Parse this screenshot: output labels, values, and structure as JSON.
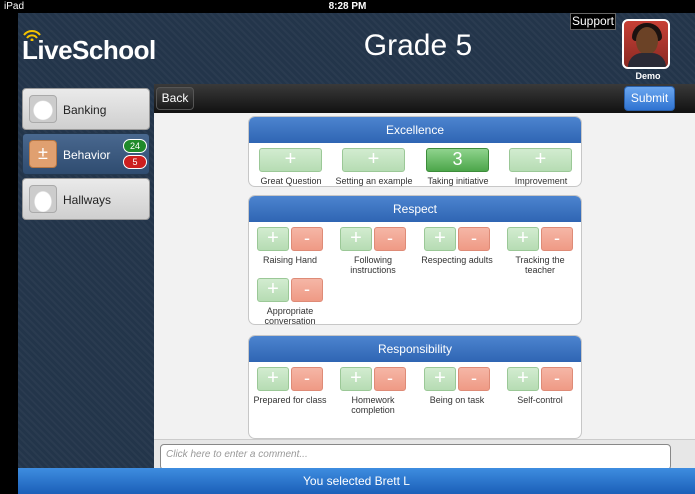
{
  "statusbar": {
    "device": "iPad",
    "time": "8:28 PM"
  },
  "header": {
    "logo": "LiveSchool",
    "title": "Grade 5",
    "support_label": "Support",
    "user_label": "Demo"
  },
  "sidebar": {
    "items": [
      {
        "label": "Banking",
        "icon": "piggy-bank-icon"
      },
      {
        "label": "Behavior",
        "icon": "plus-minus-icon",
        "badge_positive": "24",
        "badge_negative": "5"
      },
      {
        "label": "Hallways",
        "icon": "bell-icon"
      }
    ]
  },
  "toolbar": {
    "back_label": "Back",
    "submit_label": "Submit"
  },
  "sections": [
    {
      "title": "Excellence",
      "behaviors": [
        {
          "label": "Great Question",
          "plus": "+"
        },
        {
          "label": "Setting an example",
          "plus": "+"
        },
        {
          "label": "Taking initiative",
          "plus": "3"
        },
        {
          "label": "Improvement",
          "plus": "+"
        }
      ]
    },
    {
      "title": "Respect",
      "behaviors": [
        {
          "label": "Raising Hand",
          "plus": "+",
          "minus": "-"
        },
        {
          "label": "Following instructions",
          "plus": "+",
          "minus": "-"
        },
        {
          "label": "Respecting adults",
          "plus": "+",
          "minus": "-"
        },
        {
          "label": "Tracking the teacher",
          "plus": "+",
          "minus": "-"
        },
        {
          "label": "Appropriate conversation",
          "plus": "+",
          "minus": "-"
        }
      ]
    },
    {
      "title": "Responsibility",
      "behaviors": [
        {
          "label": "Prepared for class",
          "plus": "+",
          "minus": "-"
        },
        {
          "label": "Homework completion",
          "plus": "+",
          "minus": "-"
        },
        {
          "label": "Being on task",
          "plus": "+",
          "minus": "-"
        },
        {
          "label": "Self-control",
          "plus": "+",
          "minus": "-"
        }
      ]
    }
  ],
  "comment": {
    "placeholder": "Click here to enter a comment..."
  },
  "footer": {
    "selection_text": "You selected Brett L"
  },
  "colors": {
    "accent": "#2f65b3",
    "positive": "#4ca64a",
    "negative": "#ef9a85"
  }
}
